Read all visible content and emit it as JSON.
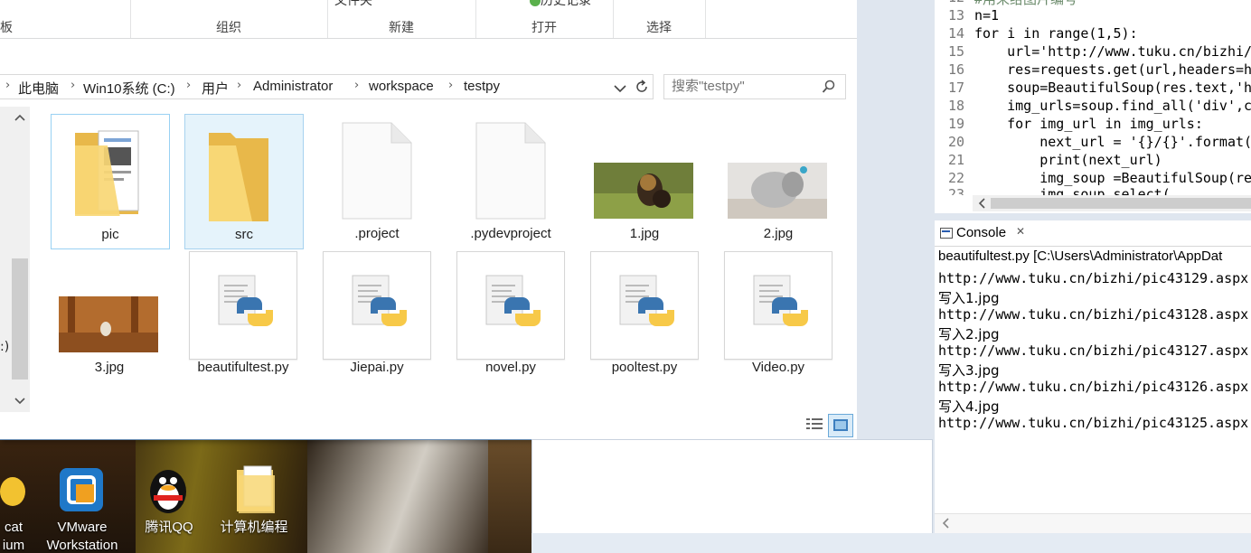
{
  "ribbon": {
    "top_labels": [
      "文件夹",
      "历史记录"
    ],
    "groups": [
      "板",
      "组织",
      "新建",
      "打开",
      "选择"
    ]
  },
  "breadcrumb": [
    "此电脑",
    "Win10系统 (C:)",
    "用户",
    "Administrator",
    "workspace",
    "testpy"
  ],
  "search": {
    "placeholder": "搜索\"testpy\""
  },
  "files_row1": [
    {
      "name": "pic",
      "type": "folder"
    },
    {
      "name": "src",
      "type": "folder"
    },
    {
      "name": ".project",
      "type": "file"
    },
    {
      "name": ".pydevproject",
      "type": "file"
    },
    {
      "name": "1.jpg",
      "type": "image"
    },
    {
      "name": "2.jpg",
      "type": "image"
    }
  ],
  "files_row2": [
    {
      "name": "3.jpg",
      "type": "image"
    },
    {
      "name": "beautifultest.py",
      "type": "python"
    },
    {
      "name": "Jiepai.py",
      "type": "python"
    },
    {
      "name": "novel.py",
      "type": "python"
    },
    {
      "name": "pooltest.py",
      "type": "python"
    },
    {
      "name": "Video.py",
      "type": "python"
    }
  ],
  "left_partial": ":)",
  "desktop": {
    "icons": [
      {
        "label1": "cat",
        "label2": "ium"
      },
      {
        "label1": "VMware",
        "label2": "Workstation"
      },
      {
        "label1": "腾讯QQ",
        "label2": ""
      },
      {
        "label1": "计算机编程",
        "label2": ""
      }
    ]
  },
  "editor": {
    "lines": [
      {
        "n": "12",
        "text": "#用来给图片编号"
      },
      {
        "n": "13",
        "text": "n=1"
      },
      {
        "n": "14",
        "text": "for i in range(1,5):"
      },
      {
        "n": "15",
        "text": "    url='http://www.tuku.cn/bizhi/"
      },
      {
        "n": "16",
        "text": "    res=requests.get(url,headers=h"
      },
      {
        "n": "17",
        "text": "    soup=BeautifulSoup(res.text,'h"
      },
      {
        "n": "18",
        "text": "    img_urls=soup.find_all('div',c"
      },
      {
        "n": "19",
        "text": "    for img_url in img_urls:"
      },
      {
        "n": "20",
        "text": "        next_url = '{}/{}'.format("
      },
      {
        "n": "21",
        "text": "        print(next_url)"
      },
      {
        "n": "22",
        "text": "        img_soup =BeautifulSoup(re"
      },
      {
        "n": "23",
        "text": "        img_soup.select(..."
      }
    ]
  },
  "console": {
    "tab": "Console",
    "header": "beautifultest.py [C:\\Users\\Administrator\\AppDat",
    "lines": [
      "http://www.tuku.cn/bizhi/pic43129.aspx",
      "写入1.jpg",
      "http://www.tuku.cn/bizhi/pic43128.aspx",
      "写入2.jpg",
      "http://www.tuku.cn/bizhi/pic43127.aspx",
      "写入3.jpg",
      "http://www.tuku.cn/bizhi/pic43126.aspx",
      "写入4.jpg",
      "http://www.tuku.cn/bizhi/pic43125.aspx"
    ]
  },
  "colors": {
    "folder": "#f8d775",
    "selection": "#e5f3fb",
    "keyword": "#0000c0",
    "string": "#2a00ff"
  }
}
